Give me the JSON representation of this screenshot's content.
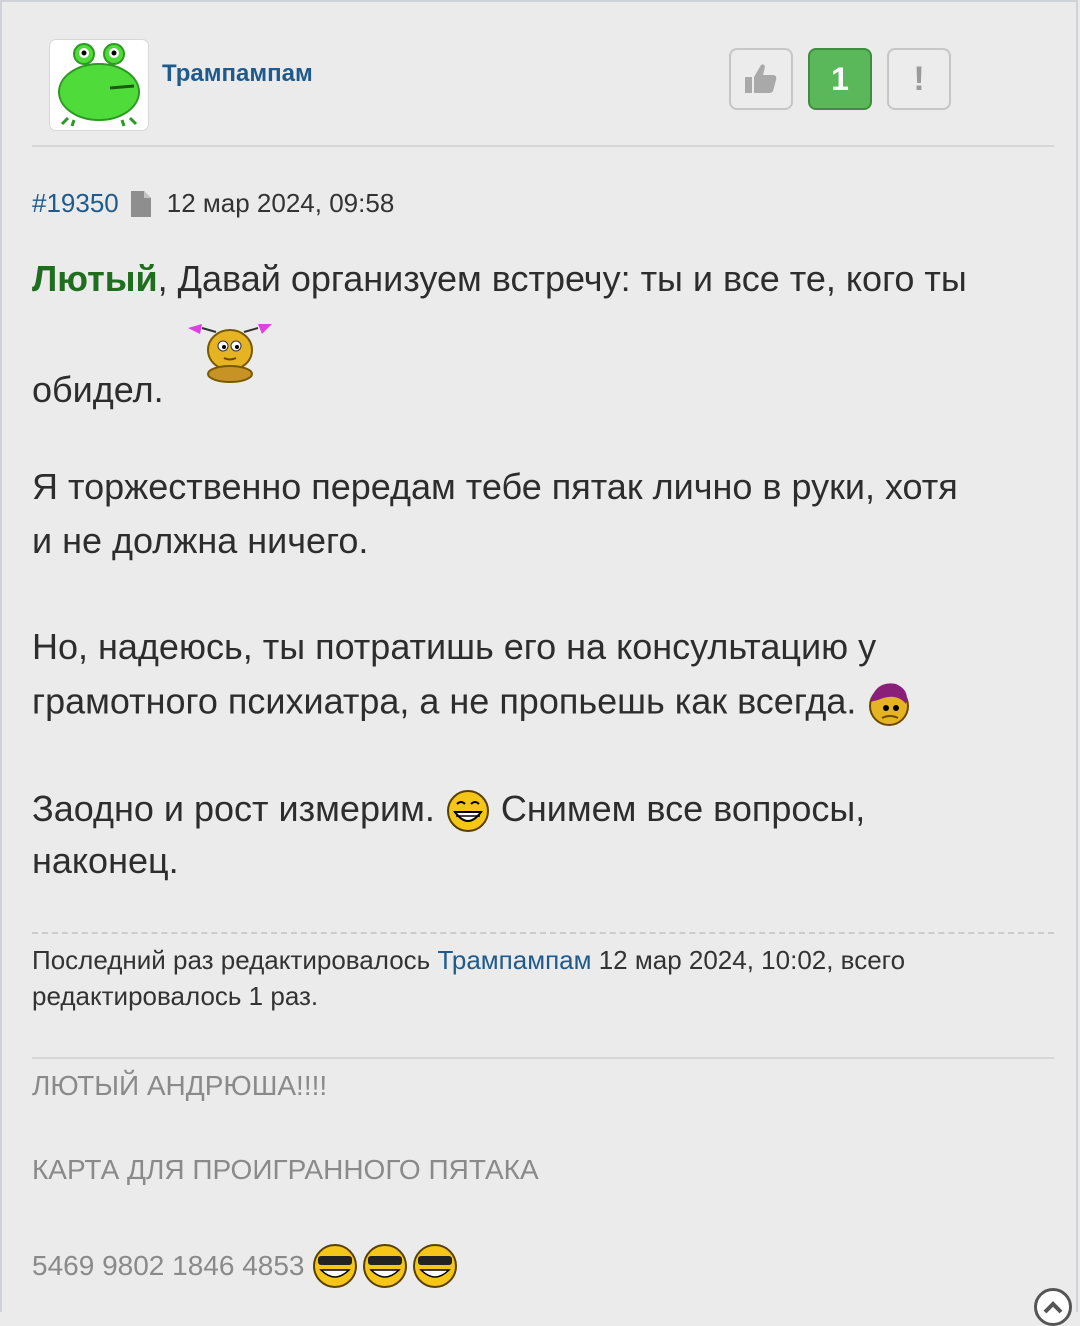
{
  "post": {
    "author": "Трампампам",
    "likes_count": "1",
    "report_label": "!",
    "id": "#19350",
    "date": "12 мар 2024, 09:58"
  },
  "content": {
    "mention": "Лютый",
    "line1_rest": ", Давай организуем встречу: ты и все те, кого ты",
    "line2": "обидел.",
    "p2_line1": "Я торжественно передам тебе пятак лично в руки, хотя",
    "p2_line2": "и не должна ничего.",
    "p3_line1": "Но, надеюсь, ты потратишь его на консультацию у",
    "p3_line2": "грамотного психиатра, а не пропьешь как всегда.",
    "p4_line1a": "Заодно и рост измерим.",
    "p4_line1b": "Снимем все вопросы,",
    "p4_line2": "наконец."
  },
  "edit_note": {
    "prefix": "Последний раз редактировалось ",
    "editor": "Трампампам",
    "suffix": " 12 мар 2024, 10:02, всего",
    "line2": "редактировалось 1 раз."
  },
  "signature": {
    "line1": "ЛЮТЫЙ АНДРЮША!!!!",
    "line2": "КАРТА ДЛЯ ПРОИГРАННОГО ПЯТАКА",
    "line3": "5469 9802 1846 4853"
  },
  "icons": {
    "like": "thumbs-up-icon",
    "document": "document-icon",
    "scroll_top": "chevron-up-icon"
  },
  "colors": {
    "link": "#1f5a8c",
    "mention": "#1e6e1e",
    "vote_green": "#5bb85a",
    "background": "#ebebec"
  }
}
